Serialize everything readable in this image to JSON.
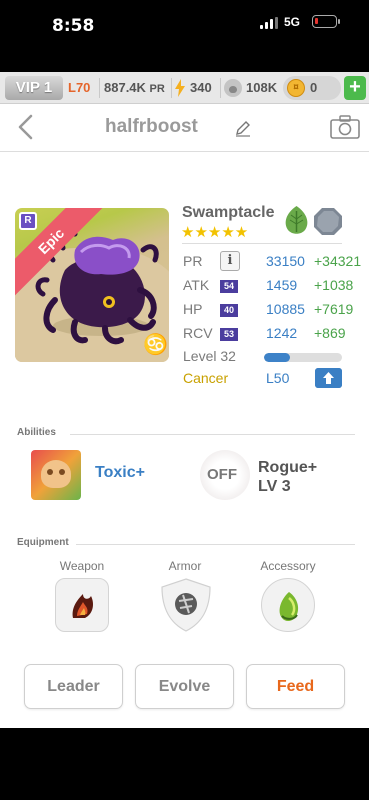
{
  "status_bar": {
    "time": "8:58",
    "network": "5G"
  },
  "resources": {
    "vip": "VIP 1",
    "level": "L70",
    "gold": "887.4K",
    "gold_unit": "PR",
    "energy": "340",
    "pets": "108K",
    "coins": "0",
    "add": "+"
  },
  "header": {
    "player_name": "halfrboost"
  },
  "pet": {
    "rarity": "Epic",
    "rarity_badge": "R",
    "zodiac_symbol": "♋",
    "species": "Swamptacle",
    "stars": "★★★★★",
    "star_count": 5,
    "elements": [
      "leaf-icon",
      "rock-icon"
    ],
    "stats": [
      {
        "label": "PR",
        "tag": "",
        "value": "33150",
        "bonus": "+34321"
      },
      {
        "label": "ATK",
        "tag": "54",
        "value": "1459",
        "bonus": "+1038"
      },
      {
        "label": "HP",
        "tag": "40",
        "value": "10885",
        "bonus": "+7619"
      },
      {
        "label": "RCV",
        "tag": "53",
        "value": "1242",
        "bonus": "+869"
      }
    ],
    "info_glyph": "i",
    "level_text": "Level 32",
    "level_progress": 0.33,
    "zodiac": "Cancer",
    "max_level": "L50"
  },
  "abilities": {
    "title": "Abilities",
    "items": [
      {
        "name": "Toxic+",
        "state": ""
      },
      {
        "name": "Rogue+",
        "level": "LV 3",
        "state": "OFF"
      }
    ]
  },
  "equipment": {
    "title": "Equipment",
    "slots": [
      {
        "label": "Weapon"
      },
      {
        "label": "Armor"
      },
      {
        "label": "Accessory"
      }
    ]
  },
  "actions": {
    "leader": "Leader",
    "evolve": "Evolve",
    "feed": "Feed"
  },
  "colors": {
    "accent_blue": "#3a7fc4",
    "bonus_green": "#4aa34a",
    "feed_orange": "#e8681c",
    "epic_red": "#ec5b6a",
    "star_gold": "#f2c200"
  }
}
